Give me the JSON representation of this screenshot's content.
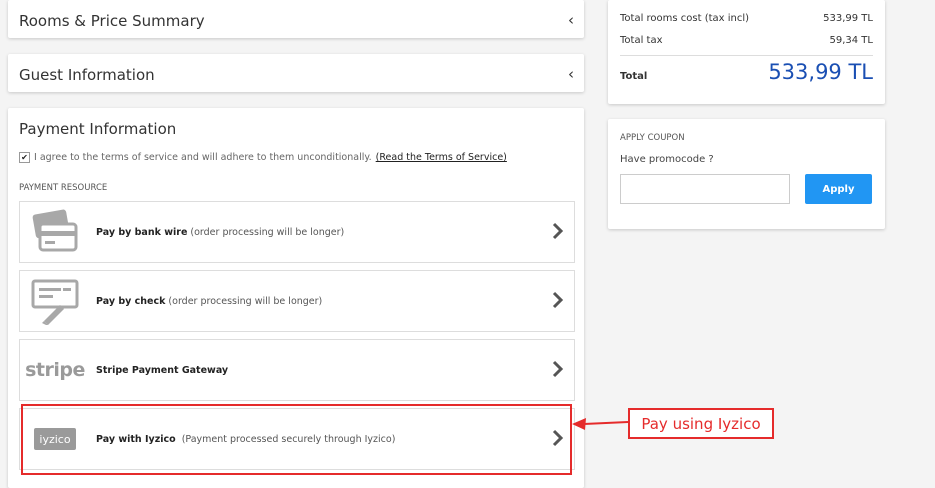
{
  "accordion": {
    "rooms_title": "Rooms & Price Summary",
    "guest_title": "Guest Information"
  },
  "payment": {
    "title": "Payment Information",
    "terms_text": "I agree to the terms of service and will adhere to them unconditionally.",
    "terms_link": "(Read the Terms of Service)",
    "resource_label": "PAYMENT RESOURCE",
    "methods": [
      {
        "name": "Pay by bank wire",
        "note": "(order processing will be longer)",
        "icon": "bank-card-icon"
      },
      {
        "name": "Pay by check",
        "note": "(order processing will be longer)",
        "icon": "check-icon"
      },
      {
        "name": "Stripe Payment Gateway",
        "note": "",
        "icon": "stripe-logo",
        "logo_text": "stripe"
      },
      {
        "name": "Pay with Iyzico",
        "note": "(Payment processed securely through Iyzico)",
        "icon": "iyzico-logo",
        "logo_text": "iyzico"
      }
    ]
  },
  "summary": {
    "rooms_cost_label": "Total rooms cost (tax incl)",
    "rooms_cost_value": "533,99 TL",
    "tax_label": "Total tax",
    "tax_value": "59,34 TL",
    "total_label": "Total",
    "total_value": "533,99 TL"
  },
  "coupon": {
    "heading": "APPLY COUPON",
    "promo_label": "Have promocode ?",
    "input_value": "",
    "apply_label": "Apply"
  },
  "annotation": {
    "callout_text": "Pay using Iyzico"
  },
  "colors": {
    "accent_blue": "#2196f3",
    "total_blue": "#1a4fb3",
    "annotation_red": "#e52b2b"
  }
}
